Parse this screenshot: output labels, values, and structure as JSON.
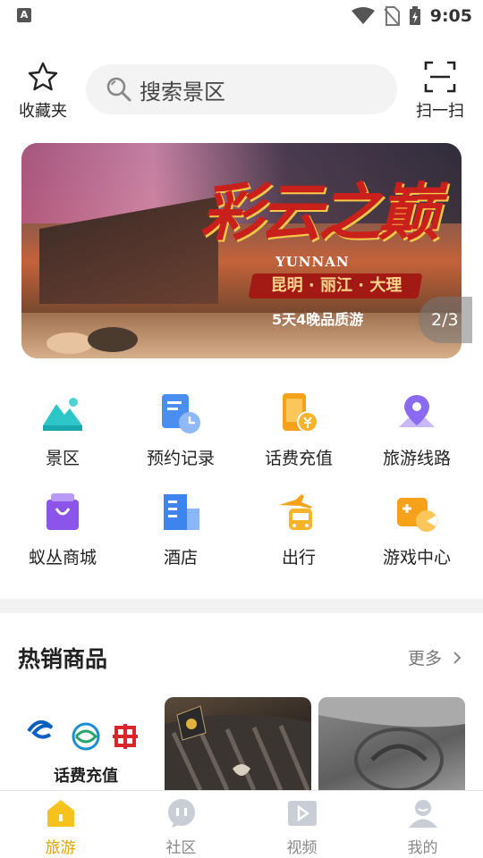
{
  "status_bar": {
    "time": "9:05",
    "notification_letter": "A"
  },
  "header": {
    "favorites_label": "收藏夹",
    "search_placeholder": "搜索景区",
    "scan_label": "扫一扫"
  },
  "banner": {
    "title": "彩云之巅",
    "english": "YUNNAN",
    "route": "昆明 · 丽江 · 大理",
    "subtitle": "5天4晚品质游",
    "pager": "2/3"
  },
  "grid": [
    {
      "label": "景区",
      "icon": "mountain-icon"
    },
    {
      "label": "预约记录",
      "icon": "record-clock-icon"
    },
    {
      "label": "话费充值",
      "icon": "phone-recharge-icon"
    },
    {
      "label": "旅游线路",
      "icon": "map-pin-icon"
    },
    {
      "label": "蚁丛商城",
      "icon": "shopping-bag-icon"
    },
    {
      "label": "酒店",
      "icon": "hotel-building-icon"
    },
    {
      "label": "出行",
      "icon": "plane-bus-icon"
    },
    {
      "label": "游戏中心",
      "icon": "gamepad-icon"
    }
  ],
  "hot_products": {
    "title": "热销商品",
    "more_label": "更多",
    "items": [
      {
        "label": "话费充值"
      }
    ]
  },
  "bottom_nav": [
    {
      "label": "旅游",
      "active": true
    },
    {
      "label": "社区",
      "active": false
    },
    {
      "label": "视频",
      "active": false
    },
    {
      "label": "我的",
      "active": false
    }
  ],
  "colors": {
    "accent": "#e2a400",
    "search_bg": "#f3f3f3",
    "divider": "#f2f2f2"
  }
}
